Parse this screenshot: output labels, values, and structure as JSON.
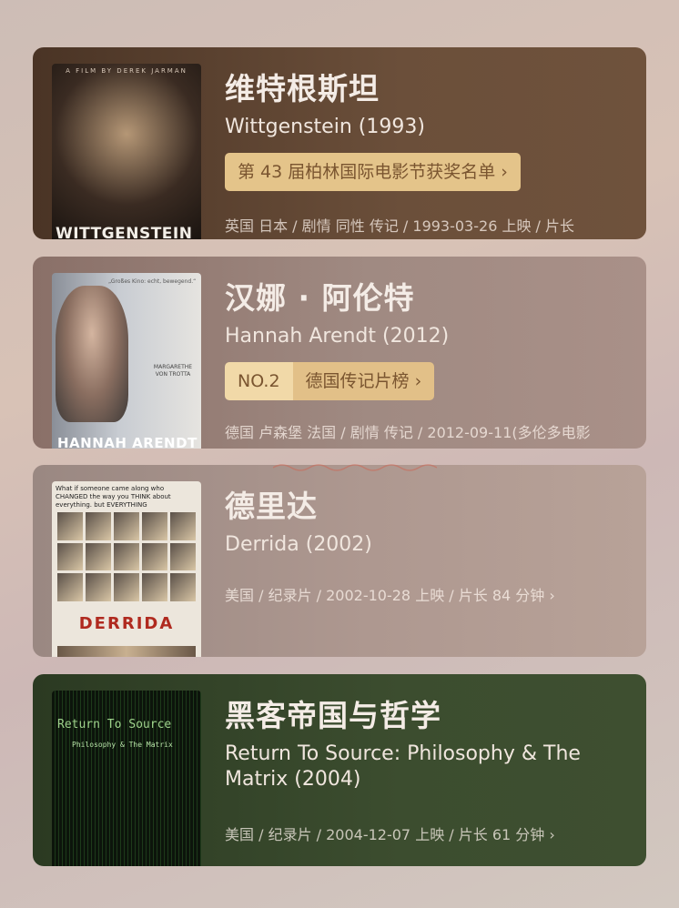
{
  "movies": [
    {
      "title_cn": "维特根斯坦",
      "title_en": "Wittgenstein (1993)",
      "badge": "第 43 届柏林国际电影节获奖名单 ›",
      "meta": "英国 日本 / 剧情 同性 传记 / 1993-03-26 上映 / 片长",
      "poster": {
        "top_text": "A FILM BY DEREK JARMAN",
        "bottom_text": "WITTGENSTEIN"
      }
    },
    {
      "title_cn": "汉娜 · 阿伦特",
      "title_en": "Hannah Arendt (2012)",
      "badge_no": "NO.2",
      "badge": "德国传记片榜 ›",
      "meta": "德国 卢森堡 法国 / 剧情 传记 / 2012-09-11(多伦多电影",
      "poster": {
        "quote": "„Großes Kino: echt, bewegend.“",
        "credit": "MARGARETHE VON TROTTA",
        "bottom_text": "HANNAH ARENDT"
      }
    },
    {
      "title_cn": "德里达",
      "title_en": "Derrida (2002)",
      "meta": "美国 / 纪录片 / 2002-10-28 上映 / 片长 84 分钟 ›",
      "poster": {
        "head": "What if someone came along who CHANGED the way you THINK about everything. but EVERYTHING",
        "bottom_text": "DERRIDA"
      }
    },
    {
      "title_cn": "黑客帝国与哲学",
      "title_en": "Return To Source: Philosophy & The Matrix (2004)",
      "meta": "美国 / 纪录片 / 2004-12-07 上映 / 片长 61 分钟 ›",
      "poster": {
        "title": "Return To Source",
        "subtitle": "Philosophy & The Matrix"
      }
    }
  ]
}
